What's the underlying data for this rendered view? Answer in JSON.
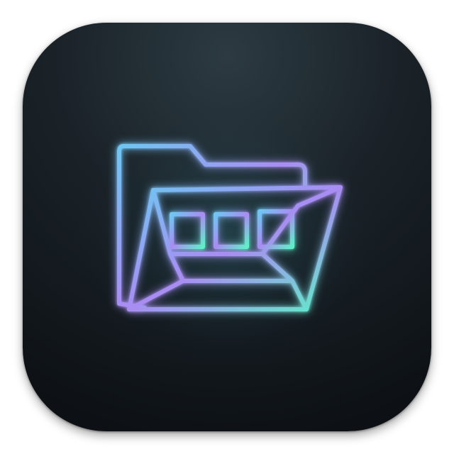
{
  "app_icon": {
    "icon_name": "open-folder-icon",
    "inner_icon_name": "window-panels-icon",
    "colors": {
      "background_top": "#28353d",
      "background_bottom": "#0f1418",
      "stroke_start": "#6fc6f2",
      "stroke_mid": "#a98cf2",
      "stroke_end": "#5ef0c8",
      "glow": "#5fd8e0"
    }
  }
}
